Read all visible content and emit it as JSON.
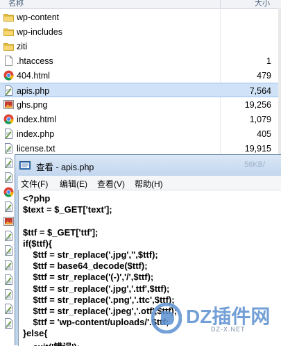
{
  "file_list": {
    "header": {
      "name": "名称",
      "size": "大小"
    },
    "rows": [
      {
        "icon": "folder-icon",
        "name": "wp-content",
        "size": ""
      },
      {
        "icon": "folder-icon",
        "name": "wp-includes",
        "size": ""
      },
      {
        "icon": "folder-icon",
        "name": "ziti",
        "size": ""
      },
      {
        "icon": "file-icon",
        "name": ".htaccess",
        "size": "1"
      },
      {
        "icon": "chrome-icon",
        "name": "404.html",
        "size": "479"
      },
      {
        "icon": "php-file-icon",
        "name": "apis.php",
        "size": "7,564",
        "selected": true
      },
      {
        "icon": "image-file-icon",
        "name": "ghs.png",
        "size": "19,256"
      },
      {
        "icon": "chrome-icon",
        "name": "index.html",
        "size": "1,079"
      },
      {
        "icon": "php-file-icon",
        "name": "index.php",
        "size": "405"
      },
      {
        "icon": "text-file-icon",
        "name": "license.txt",
        "size": "19,915"
      }
    ]
  },
  "notepad": {
    "title": "查看 - apis.php",
    "faded_title_fragment": "56KB/",
    "menu": [
      "文件(F)",
      "编辑(E)",
      "查看(V)",
      "帮助(H)"
    ],
    "code_lines": [
      "<?php",
      "$text = $_GET['text'];",
      "",
      "$ttf = $_GET['ttf'];",
      "if($ttf){",
      "    $ttf = str_replace('.jpg','',$ttf);",
      "    $ttf = base64_decode($ttf);",
      "    $ttf = str_replace('(-)','/',$ttf);",
      "    $ttf = str_replace('.jpg','.ttf',$ttf);",
      "    $ttf = str_replace('.png','.ttc',$ttf);",
      "    $ttf = str_replace('.jpeg','.otf',$ttf);",
      "    $ttf = 'wp-content/uploads/'.$ttf;",
      "}else{",
      "    exit('错误');"
    ]
  },
  "watermark": {
    "text": "DZ插件网",
    "sub": "DZ-X.NET"
  }
}
